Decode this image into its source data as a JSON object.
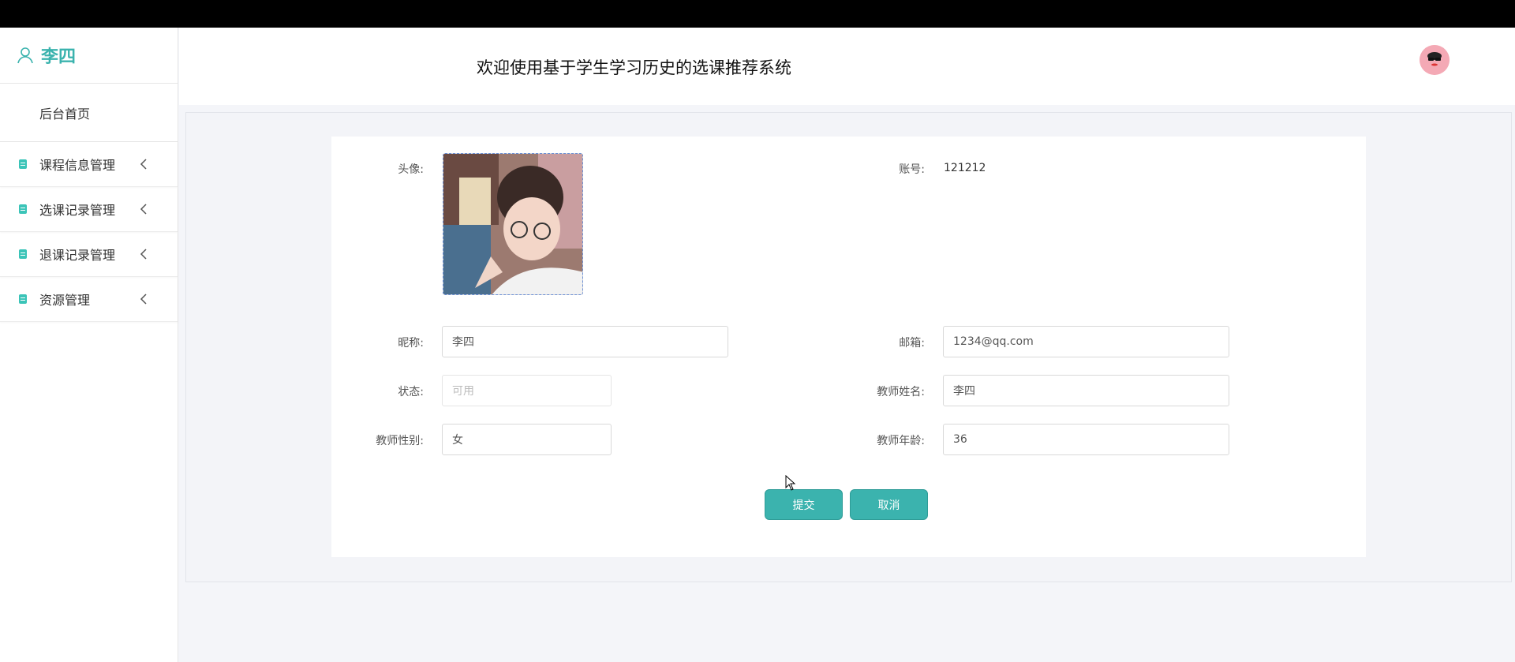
{
  "sidebar": {
    "user_name": "李四",
    "home_label": "后台首页",
    "items": [
      {
        "label": "课程信息管理"
      },
      {
        "label": "选课记录管理"
      },
      {
        "label": "退课记录管理"
      },
      {
        "label": "资源管理"
      }
    ]
  },
  "header": {
    "title": "欢迎使用基于学生学习历史的选课推荐系统"
  },
  "form": {
    "avatar_label": "头像:",
    "account_label": "账号:",
    "account_value": "121212",
    "nickname_label": "昵称:",
    "nickname_value": "李四",
    "email_label": "邮箱:",
    "email_value": "1234@qq.com",
    "status_label": "状态:",
    "status_value": "可用",
    "teacher_name_label": "教师姓名:",
    "teacher_name_value": "李四",
    "teacher_gender_label": "教师性别:",
    "teacher_gender_value": "女",
    "teacher_age_label": "教师年龄:",
    "teacher_age_value": "36",
    "submit_label": "提交",
    "cancel_label": "取消"
  },
  "colors": {
    "accent": "#3bb3ae",
    "topbar": "#000000",
    "avatar_bg": "#f4a9b5"
  }
}
